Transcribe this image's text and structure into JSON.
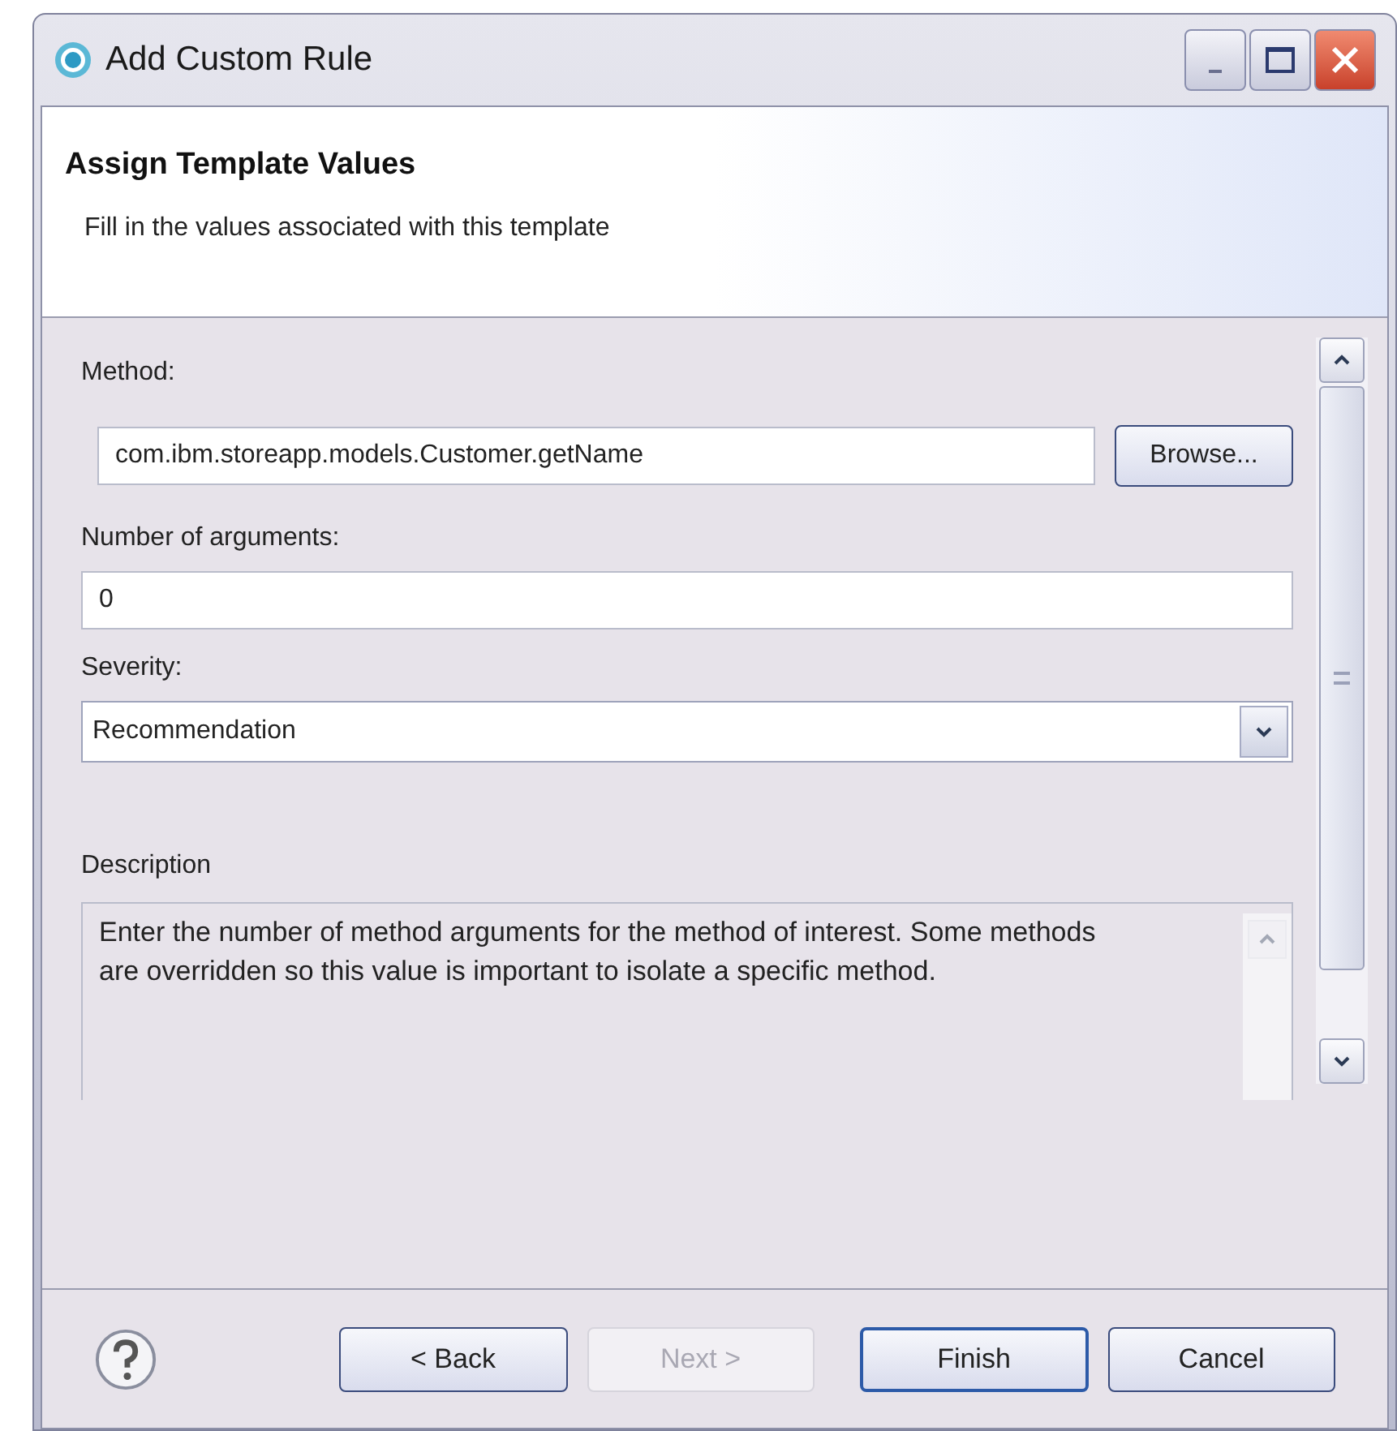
{
  "window": {
    "title": "Add Custom Rule"
  },
  "header": {
    "title": "Assign Template Values",
    "subtitle": "Fill in the values associated with this template"
  },
  "form": {
    "method": {
      "label": "Method:",
      "value": "com.ibm.storeapp.models.Customer.getName",
      "button": "Browse..."
    },
    "arguments": {
      "label": "Number of arguments:",
      "value": "0"
    },
    "severity": {
      "label": "Severity:",
      "value": "Recommendation"
    },
    "description": {
      "label": "Description",
      "text": "Enter the number of method arguments for the method of interest. Some methods are overridden so this value is important to isolate a specific method."
    }
  },
  "buttons": [
    {
      "label": "< Back",
      "disabled": false,
      "default": false
    },
    {
      "label": "Next >",
      "disabled": true,
      "default": false
    },
    {
      "label": "Finish",
      "disabled": false,
      "default": true
    },
    {
      "label": "Cancel",
      "disabled": false,
      "default": false
    }
  ]
}
